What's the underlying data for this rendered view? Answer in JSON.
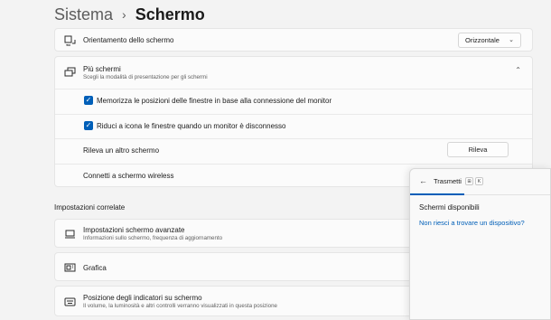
{
  "breadcrumb": {
    "parent": "Sistema",
    "separator": "›",
    "current": "Schermo"
  },
  "orientation": {
    "icon": "screen-rotate-icon",
    "label": "Orientamento dello schermo",
    "value": "Orizzontale"
  },
  "multiple_displays": {
    "icon": "multiple-monitors-icon",
    "title": "Più schermi",
    "subtitle": "Scegli la modalità di presentazione per gli schermi",
    "expanded": true,
    "options": [
      {
        "label": "Memorizza le posizioni delle finestre in base alla connessione del monitor",
        "checked": true
      },
      {
        "label": "Riduci a icona le finestre quando un monitor è disconnesso",
        "checked": true
      }
    ],
    "detect_label": "Rileva un altro schermo",
    "detect_button": "Rileva",
    "wireless_label": "Connetti a schermo wireless"
  },
  "related": {
    "title": "Impostazioni correlate",
    "items": [
      {
        "icon": "laptop-monitor-icon",
        "label": "Impostazioni schermo avanzate",
        "sub": "Informazioni sullo schermo, frequenza di aggiornamento"
      },
      {
        "icon": "graphics-card-icon",
        "label": "Grafica",
        "sub": ""
      },
      {
        "icon": "keyboard-indicator-icon",
        "label": "Posizione degli indicatori su schermo",
        "sub": "Il volume, la luminosità e altri controlli verranno visualizzati in questa posizione"
      }
    ]
  },
  "cast_panel": {
    "title": "Trasmetti",
    "shortcut_keys": [
      "⊞",
      "K"
    ],
    "heading": "Schermi disponibili",
    "link": "Non riesci a trovare un dispositivo?"
  },
  "colors": {
    "accent": "#005fb8",
    "background": "#f3f3f3",
    "card": "#fbfbfb"
  }
}
